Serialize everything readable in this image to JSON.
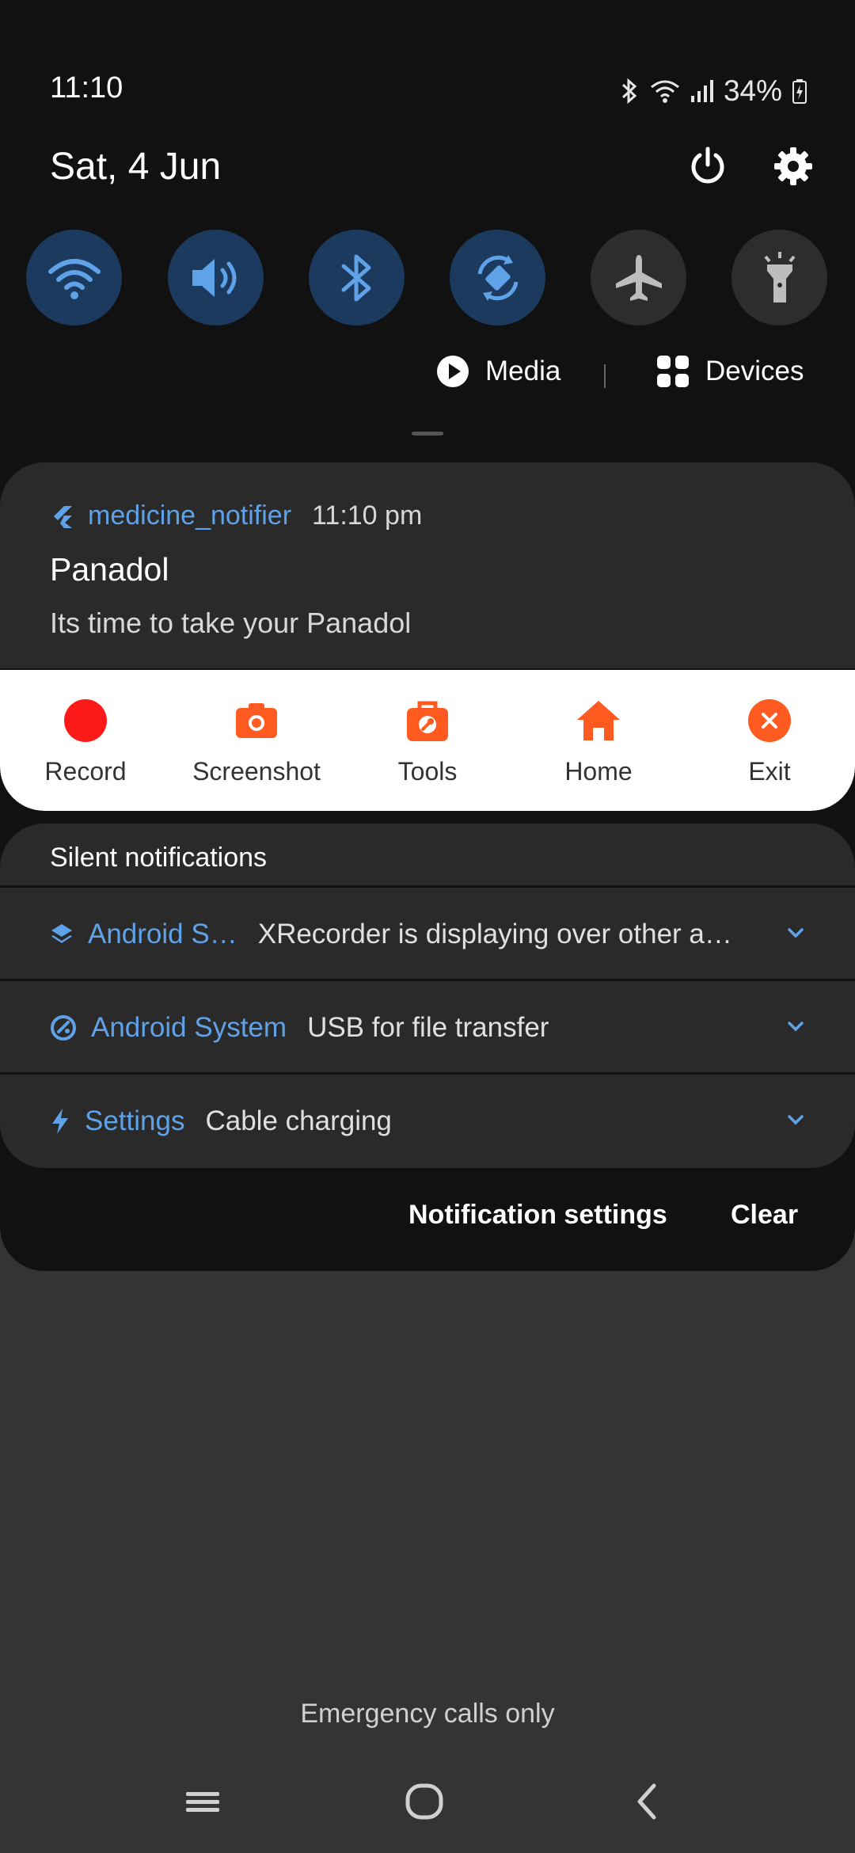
{
  "status_bar": {
    "time": "11:10",
    "battery": "34%"
  },
  "header": {
    "date": "Sat, 4 Jun"
  },
  "quick_toggles": [
    {
      "name": "wifi-icon",
      "state": "on"
    },
    {
      "name": "sound-icon",
      "state": "on"
    },
    {
      "name": "bluetooth-icon",
      "state": "on"
    },
    {
      "name": "auto-rotate-icon",
      "state": "on"
    },
    {
      "name": "airplane-icon",
      "state": "off"
    },
    {
      "name": "flashlight-icon",
      "state": "off"
    }
  ],
  "media_row": {
    "media_label": "Media",
    "devices_label": "Devices"
  },
  "notification": {
    "app_name": "medicine_notifier",
    "time": "11:10 pm",
    "title": "Panadol",
    "body": "Its time to take your Panadol",
    "actions": [
      {
        "label": "Record",
        "icon": "record-icon"
      },
      {
        "label": "Screenshot",
        "icon": "camera-icon"
      },
      {
        "label": "Tools",
        "icon": "toolbox-icon"
      },
      {
        "label": "Home",
        "icon": "home-icon"
      },
      {
        "label": "Exit",
        "icon": "close-circle-icon"
      }
    ]
  },
  "silent": {
    "title": "Silent notifications",
    "rows": [
      {
        "source": "Android S…",
        "text": "XRecorder is displaying over other a…",
        "icon": "layers-icon"
      },
      {
        "source": "Android System",
        "text": "USB for file transfer",
        "icon": "usb-icon"
      },
      {
        "source": "Settings",
        "text": "Cable charging",
        "icon": "bolt-icon"
      }
    ]
  },
  "footer": {
    "notification_settings": "Notification settings",
    "clear": "Clear",
    "emergency": "Emergency calls only"
  },
  "colors": {
    "accent_blue": "#5fa2e8",
    "action_orange": "#ff5a1f",
    "record_red": "#ff1a1a"
  }
}
